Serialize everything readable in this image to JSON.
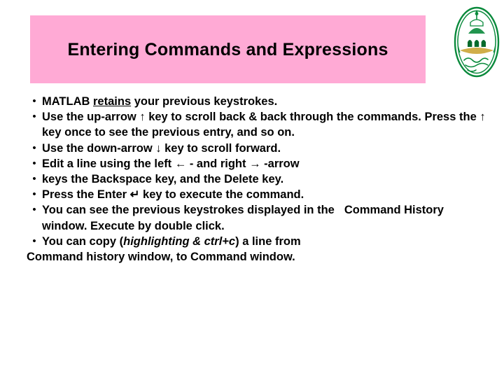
{
  "slide": {
    "title": "Entering Commands and Expressions",
    "title_bg_color": "#ffaad5",
    "bullet_char": "•",
    "logo": {
      "name": "university-crest-logo",
      "colors": {
        "green": "#0a8a3c",
        "dark_green": "#066a2c",
        "gold": "#c8a02a"
      }
    },
    "lines": [
      {
        "id": "l1",
        "bullet": true,
        "segments": [
          {
            "text": "MATLAB ",
            "style": "bold"
          },
          {
            "text": "retains",
            "style": "bold-underline"
          },
          {
            "text": " your previous keystrokes.",
            "style": "bold"
          }
        ]
      },
      {
        "id": "l2",
        "bullet": true,
        "segments": [
          {
            "text": "Use the up-arrow ↑ key to scroll back & back through the commands. Press the ↑ key once to see the previous entry, and so on.",
            "style": "bold"
          }
        ]
      },
      {
        "id": "l3",
        "bullet": true,
        "segments": [
          {
            "text": "Use the down-arrow ↓ key to scroll forward.",
            "style": "bold"
          }
        ]
      },
      {
        "id": "l4",
        "bullet": true,
        "segments": [
          {
            "text": "Edit a line using the left ← - and right → -arrow",
            "style": "bold"
          }
        ]
      },
      {
        "id": "l5",
        "bullet": true,
        "segments": [
          {
            "text": "keys the Backspace key, and the Delete key.",
            "style": "bold"
          }
        ]
      },
      {
        "id": "l6",
        "bullet": true,
        "segments": [
          {
            "text": "Press the Enter ↵ key to execute the command.",
            "style": "bold"
          }
        ]
      },
      {
        "id": "l7",
        "bullet": true,
        "segments": [
          {
            "text": "You can see the previous keystrokes displayed in the",
            "style": "bold"
          },
          {
            "text": "   Command History window. Execute by double click.",
            "style": "bold"
          }
        ]
      },
      {
        "id": "l8",
        "bullet": true,
        "segments": [
          {
            "text": "You can copy (",
            "style": "bold"
          },
          {
            "text": "highlighting & ctrl+c",
            "style": "bold-italic"
          },
          {
            "text": ") a line from",
            "style": "bold"
          }
        ]
      },
      {
        "id": "l9",
        "bullet": false,
        "segments": [
          {
            "text": "Command history window, to Command window.",
            "style": "bold"
          }
        ]
      }
    ],
    "text_runs": {
      "line1_a": "MATLAB ",
      "line1_b": "retains",
      "line1_c": " your previous keystrokes.",
      "line2": "Use the up-arrow ↑ key to scroll back & back through the commands. Press the ↑ key once to see the previous entry, and so on.",
      "line3": "Use the down-arrow ↓ key to scroll forward.",
      "line4": "Edit a line using the left ← - and right → -arrow",
      "line5": "keys the Backspace key, and the Delete key.",
      "line6": "Press the Enter ↵ key to execute the command.",
      "line7_a": "You can see the previous keystrokes displayed in the",
      "line7_b": "Command",
      "line7_c": "History window. Execute by double click.",
      "line8_a": "You can copy (",
      "line8_b": "highlighting & ctrl+c",
      "line8_c": ") a line from",
      "line9": "Command history window, to Command window."
    }
  }
}
